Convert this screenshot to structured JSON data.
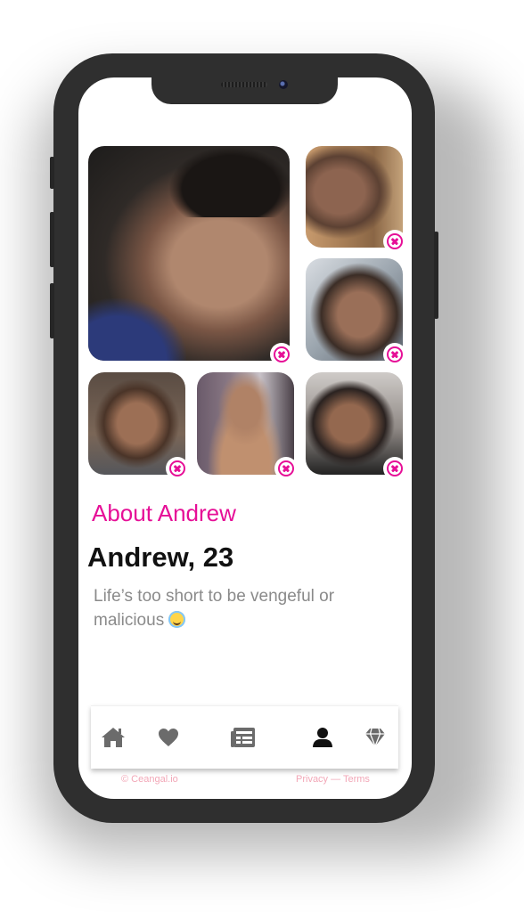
{
  "profile": {
    "about_title": "About Andrew",
    "name_age": "Andrew, 23",
    "bio": "Life’s too short to be vengeful or malicious",
    "bio_emoji": "smiling-face-with-halo"
  },
  "photos": [
    {
      "id": "photo-1",
      "remove_icon": "remove-icon"
    },
    {
      "id": "photo-2",
      "remove_icon": "remove-icon"
    },
    {
      "id": "photo-3",
      "remove_icon": "remove-icon"
    },
    {
      "id": "photo-4",
      "remove_icon": "remove-icon"
    },
    {
      "id": "photo-5",
      "remove_icon": "remove-icon"
    },
    {
      "id": "photo-6",
      "remove_icon": "remove-icon"
    }
  ],
  "tabbar": {
    "items": [
      {
        "icon": "home-icon",
        "active": false
      },
      {
        "icon": "heart-icon",
        "active": false
      },
      {
        "icon": "news-icon",
        "active": false
      },
      {
        "icon": "user-icon",
        "active": true
      },
      {
        "icon": "diamond-icon",
        "active": false
      }
    ]
  },
  "footer": {
    "copyright": "© Ceangal.io",
    "links": "Privacy — Terms"
  },
  "colors": {
    "accent": "#e60f97",
    "icon_inactive": "#6b6b6b",
    "icon_active": "#111111",
    "footer_text": "#f2a7b7"
  }
}
